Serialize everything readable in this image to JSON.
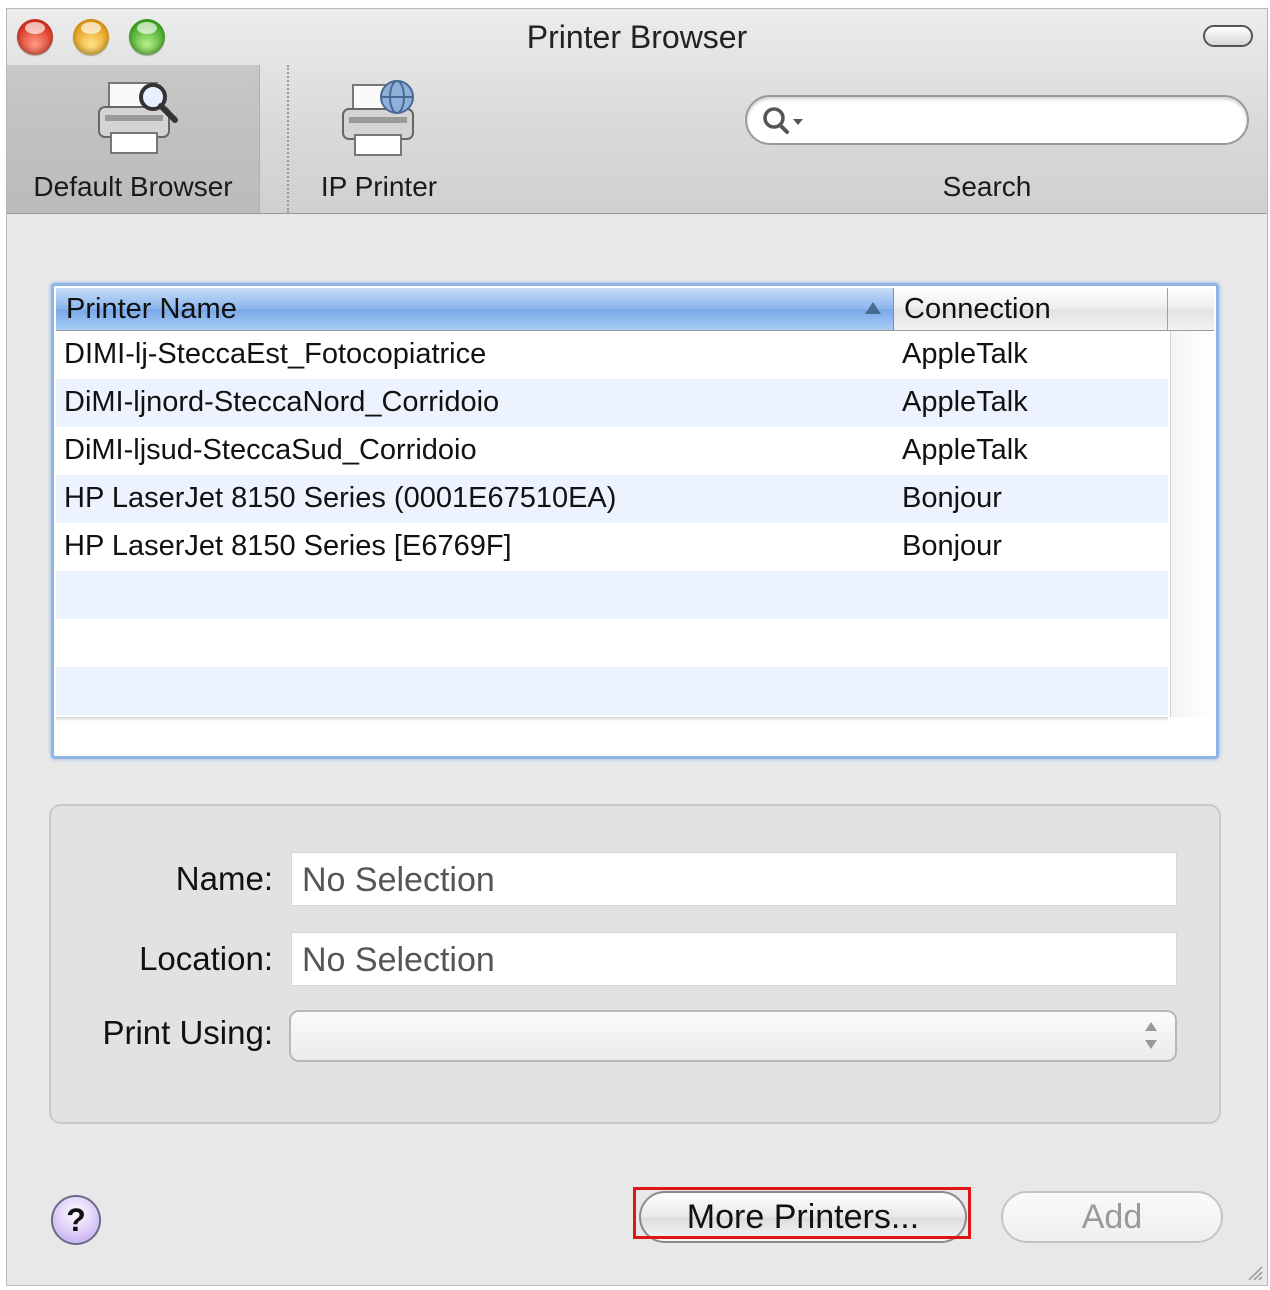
{
  "window": {
    "title": "Printer Browser"
  },
  "toolbar": {
    "default_browser_label": "Default Browser",
    "ip_printer_label": "IP Printer",
    "search_label": "Search",
    "search_value": ""
  },
  "table": {
    "columns": [
      "Printer Name",
      "Connection"
    ],
    "rows": [
      {
        "name": "DIMI-lj-SteccaEst_Fotocopiatrice",
        "connection": "AppleTalk"
      },
      {
        "name": "DiMI-ljnord-SteccaNord_Corridoio",
        "connection": "AppleTalk"
      },
      {
        "name": "DiMI-ljsud-SteccaSud_Corridoio",
        "connection": "AppleTalk"
      },
      {
        "name": "HP LaserJet 8150 Series (0001E67510EA)",
        "connection": "Bonjour"
      },
      {
        "name": "HP LaserJet 8150 Series [E6769F]",
        "connection": "Bonjour"
      },
      {
        "name": "",
        "connection": ""
      },
      {
        "name": "",
        "connection": ""
      },
      {
        "name": "",
        "connection": ""
      }
    ]
  },
  "info": {
    "name_label": "Name:",
    "name_value": "No Selection",
    "location_label": "Location:",
    "location_value": "No Selection",
    "print_using_label": "Print Using:",
    "print_using_value": ""
  },
  "buttons": {
    "help": "?",
    "more_printers": "More Printers...",
    "add": "Add"
  },
  "colors": {
    "selection_header": "#8bb6ee",
    "highlight_box": "#e01515",
    "stripe": "#edf3fe"
  }
}
